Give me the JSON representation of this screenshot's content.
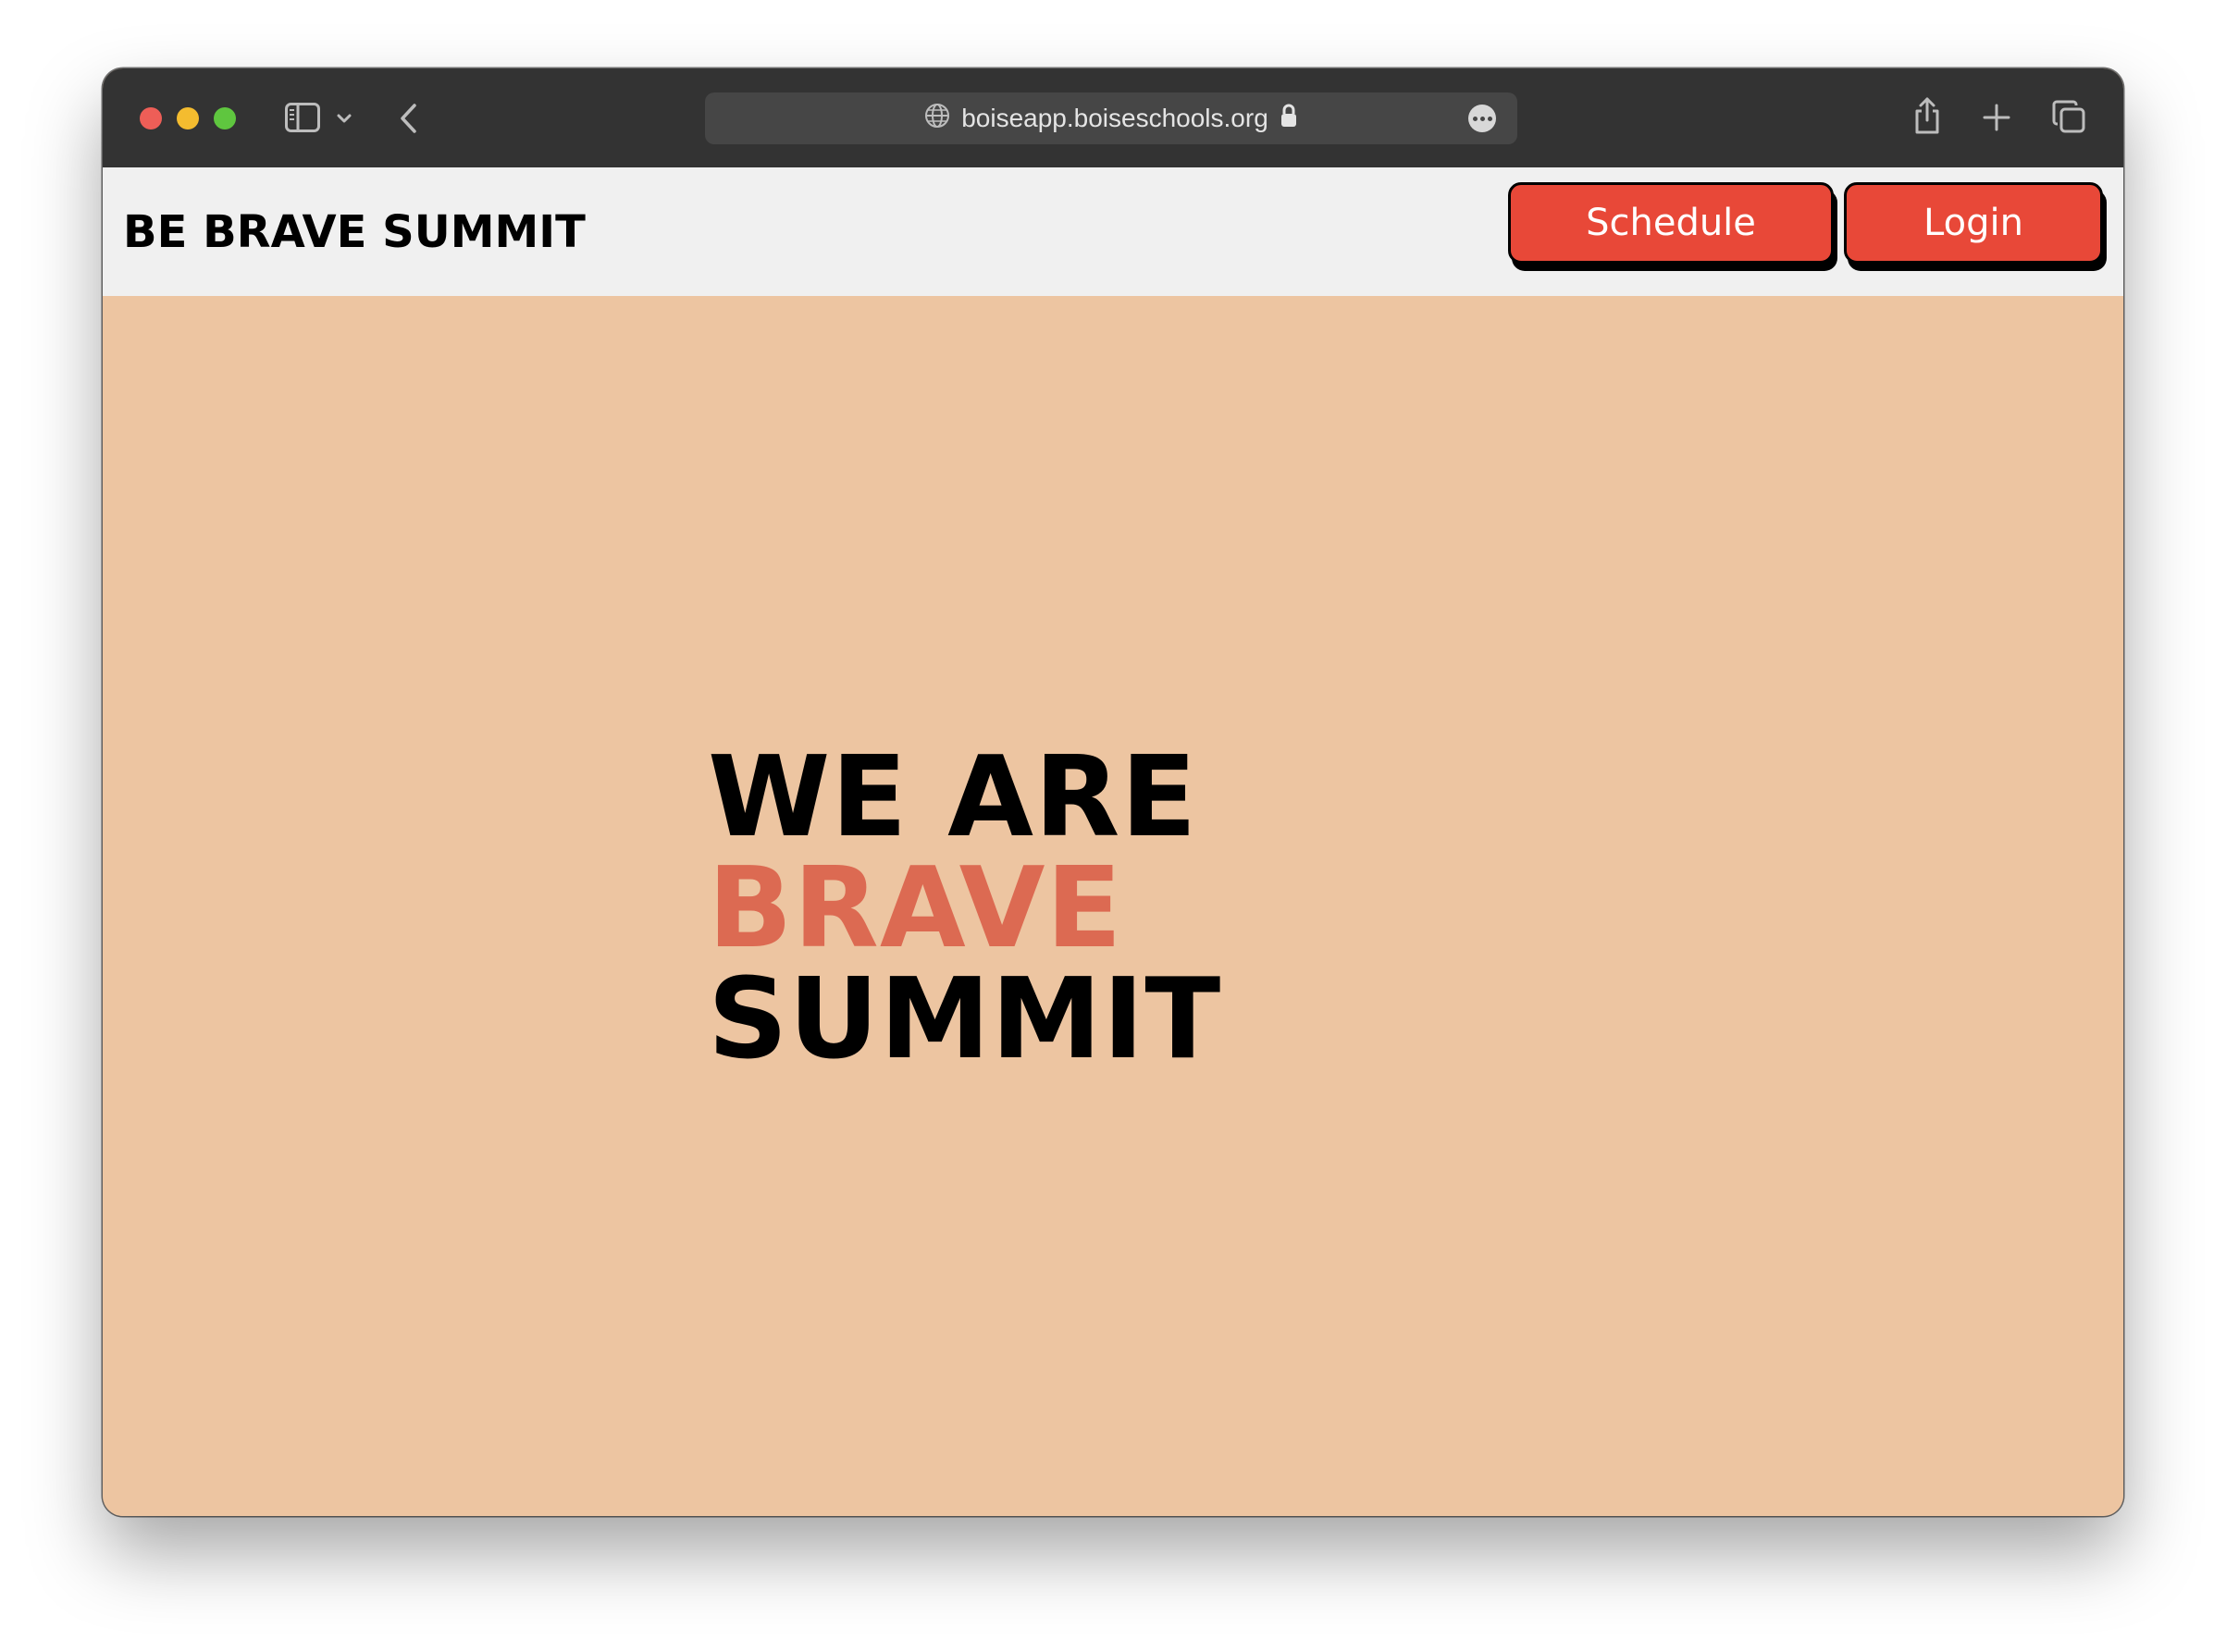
{
  "browser": {
    "url": "boiseapp.boiseschools.org",
    "traffic_lights": {
      "close": "#ee5e57",
      "minimize": "#f4bc2f",
      "zoom": "#5fc63f"
    },
    "icons": [
      "sidebar-icon",
      "chevron-down-icon",
      "back-icon",
      "globe-icon",
      "lock-icon",
      "more-icon",
      "share-icon",
      "new-tab-icon",
      "tabs-overview-icon"
    ]
  },
  "navbar": {
    "brand": "BE BRAVE SUMMIT",
    "schedule_label": "Schedule",
    "login_label": "Login",
    "button_color": "#e84838"
  },
  "hero": {
    "line1": "WE ARE",
    "line2": "BRAVE",
    "line3": "SUMMIT",
    "background": "#edc5a1",
    "accent_color": "#dc6a52"
  }
}
